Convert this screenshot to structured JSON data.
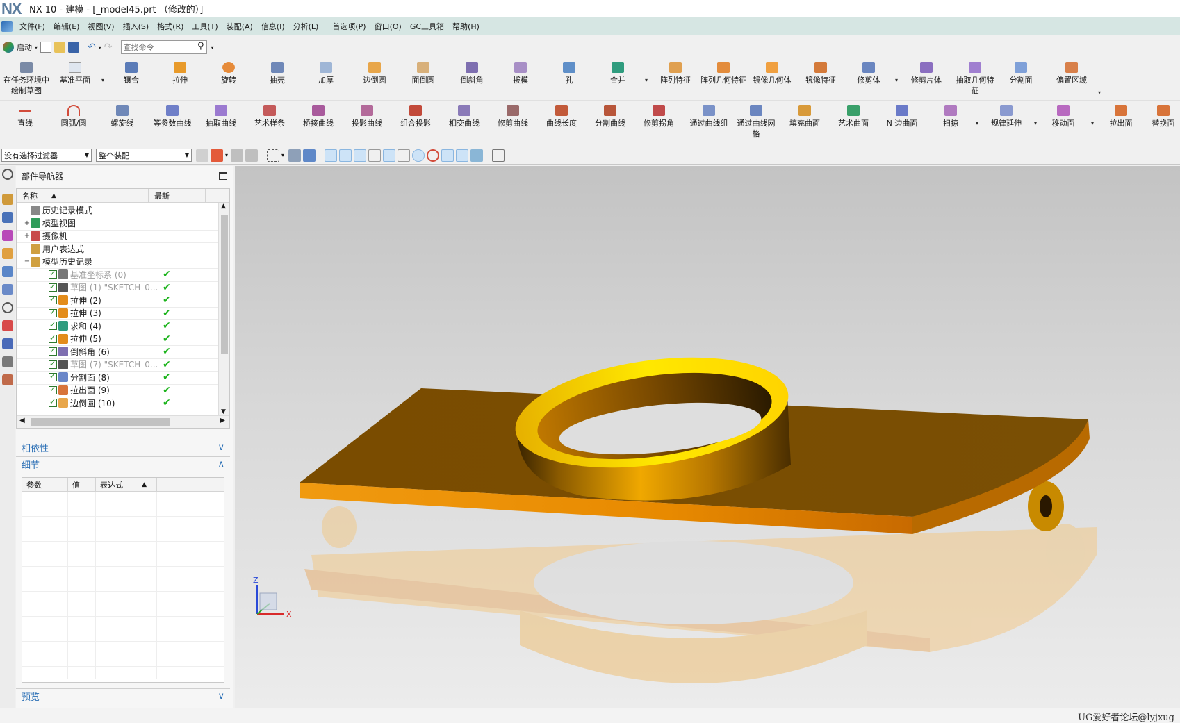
{
  "window": {
    "logo": "NX",
    "title": "NX 10 - 建模 - [_model45.prt （修改的）]"
  },
  "menu": [
    "文件(F)",
    "编辑(E)",
    "视图(V)",
    "插入(S)",
    "格式(R)",
    "工具(T)",
    "装配(A)",
    "信息(I)",
    "分析(L)",
    "首选项(P)",
    "窗口(O)",
    "GC工具箱",
    "帮助(H)"
  ],
  "quickbar": {
    "start_label": "启动",
    "search_placeholder": "查找命令"
  },
  "ribbon1": [
    "在任务环境中绘制草图",
    "基准平面",
    "镶合",
    "拉伸",
    "旋转",
    "抽壳",
    "加厚",
    "边倒圆",
    "面倒圆",
    "倒斜角",
    "拔模",
    "孔",
    "合并",
    "阵列特征",
    "阵列几何特征",
    "镜像几何体",
    "镜像特征",
    "修剪体",
    "修剪片体",
    "抽取几何特征",
    "分割面",
    "偏置区域"
  ],
  "ribbon2": [
    "直线",
    "圆弧/圆",
    "螺旋线",
    "等参数曲线",
    "抽取曲线",
    "艺术样条",
    "桥接曲线",
    "投影曲线",
    "组合投影",
    "相交曲线",
    "修剪曲线",
    "曲线长度",
    "分割曲线",
    "修剪拐角",
    "通过曲线组",
    "通过曲线网格",
    "填充曲面",
    "艺术曲面",
    "N 边曲面",
    "扫掠",
    "规律延伸",
    "移动面",
    "拉出面",
    "替换面"
  ],
  "filterbar": {
    "filter": "没有选择过滤器",
    "scope": "整个装配"
  },
  "navigator": {
    "title": "部件导航器",
    "col_name": "名称",
    "col_latest": "最新",
    "rows": [
      {
        "label": "历史记录模式",
        "type": "top"
      },
      {
        "label": "模型视图",
        "type": "top"
      },
      {
        "label": "摄像机",
        "type": "top"
      },
      {
        "label": "用户表达式",
        "type": "top"
      },
      {
        "label": "模型历史记录",
        "type": "top"
      },
      {
        "label": "基准坐标系 (0)",
        "type": "feat",
        "dim": true
      },
      {
        "label": "草图 (1) \"SKETCH_0...",
        "type": "feat",
        "dim": true
      },
      {
        "label": "拉伸 (2)",
        "type": "feat"
      },
      {
        "label": "拉伸 (3)",
        "type": "feat"
      },
      {
        "label": "求和 (4)",
        "type": "feat"
      },
      {
        "label": "拉伸 (5)",
        "type": "feat"
      },
      {
        "label": "倒斜角 (6)",
        "type": "feat"
      },
      {
        "label": "草图 (7) \"SKETCH_0...",
        "type": "feat",
        "dim": true
      },
      {
        "label": "分割面 (8)",
        "type": "feat"
      },
      {
        "label": "拉出面 (9)",
        "type": "feat"
      },
      {
        "label": "边倒圆 (10)",
        "type": "feat"
      }
    ],
    "sections": {
      "dependency": "相依性",
      "details": "细节",
      "preview": "预览"
    },
    "details_cols": [
      "参数",
      "值",
      "表达式"
    ]
  },
  "viewport": {
    "axis_z": "Z",
    "axis_x": "X"
  },
  "status": {
    "watermark": "UG爱好者论坛@lyjxug"
  },
  "colors": {
    "part_orange": "#e08a00",
    "ring_yellow": "#f2c200",
    "menubar": "#d6e6e3"
  }
}
